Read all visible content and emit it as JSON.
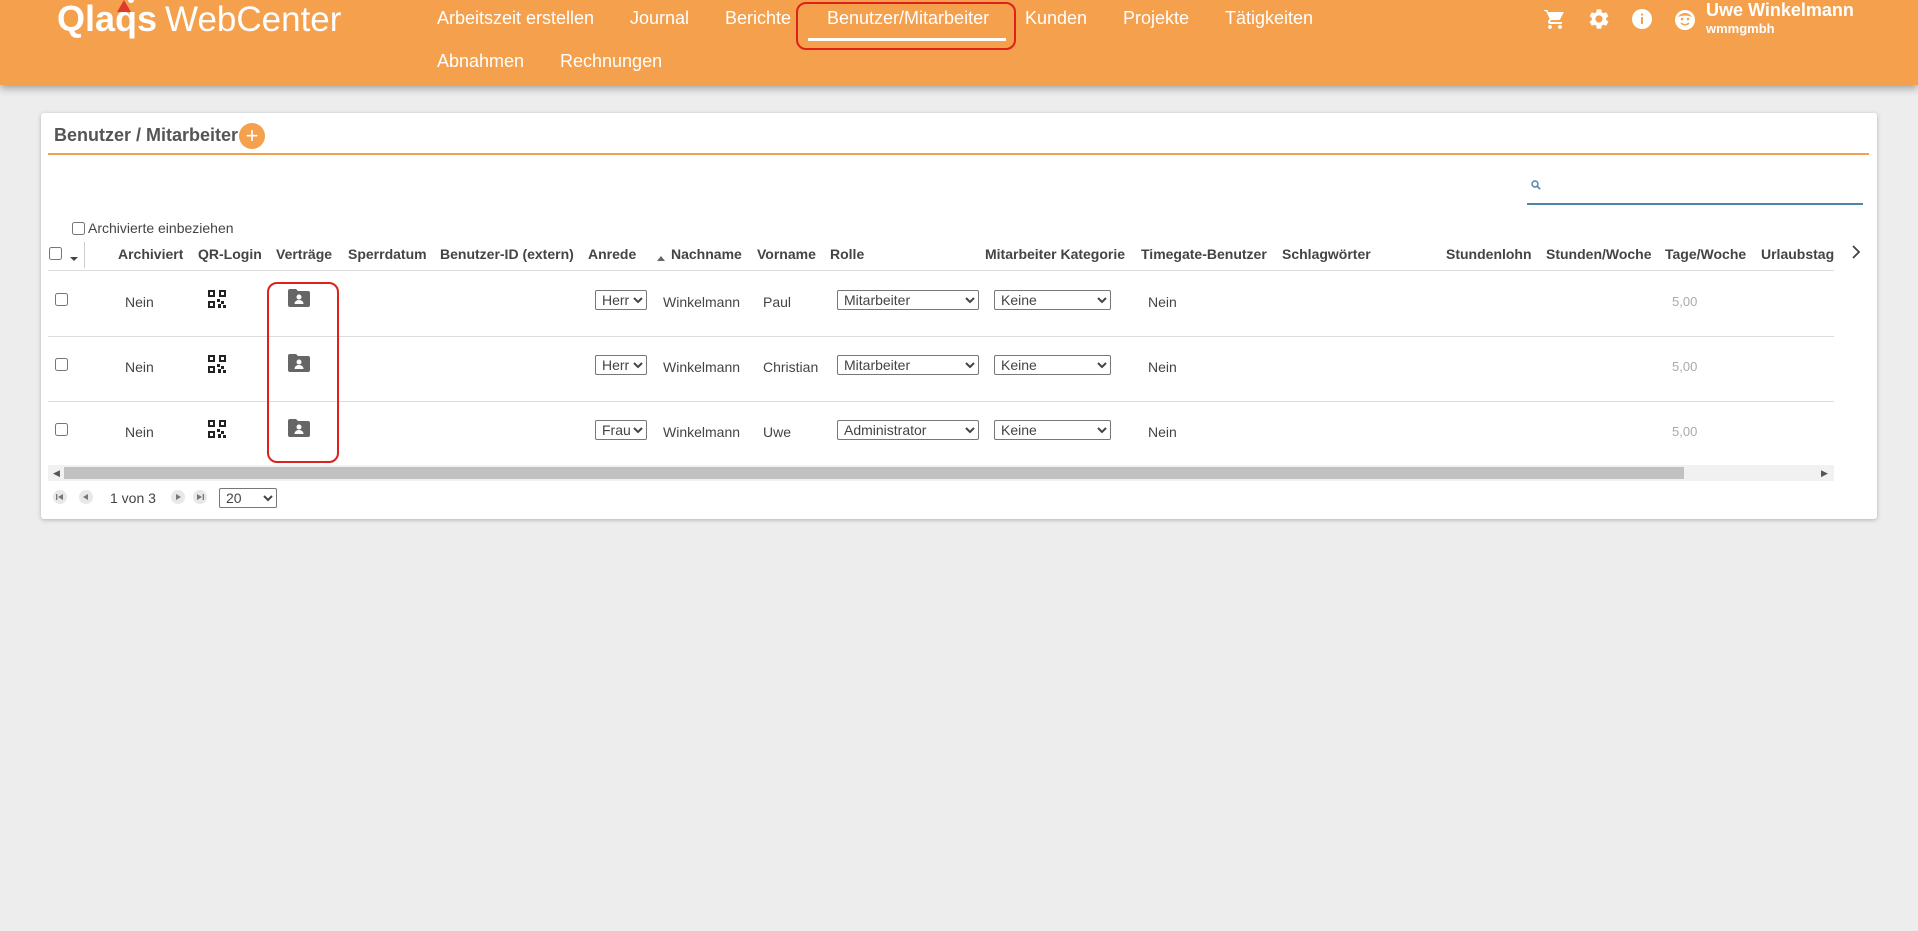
{
  "header": {
    "logo_brand": "Qlaqs",
    "logo_suffix": "WebCenter",
    "nav": [
      {
        "label": "Arbeitszeit erstellen"
      },
      {
        "label": "Journal"
      },
      {
        "label": "Berichte"
      },
      {
        "label": "Benutzer/Mitarbeiter",
        "active": true
      },
      {
        "label": "Kunden"
      },
      {
        "label": "Projekte"
      },
      {
        "label": "Tätigkeiten"
      },
      {
        "label": "Abnahmen"
      },
      {
        "label": "Rechnungen"
      }
    ],
    "icons": [
      "cart-icon",
      "gear-icon",
      "info-icon",
      "user-avatar-icon"
    ],
    "user_name": "Uwe Winkelmann",
    "user_company": "wmmgmbh",
    "accent_color": "#f5a04d"
  },
  "card": {
    "title": "Benutzer / Mitarbeiter",
    "add_label": "+",
    "archived_label": "Archivierte einbeziehen",
    "search_placeholder": ""
  },
  "table": {
    "columns": [
      "Archiviert",
      "QR-Login",
      "Verträge",
      "Sperrdatum",
      "Benutzer-ID (extern)",
      "Anrede",
      "Nachname",
      "Vorname",
      "Rolle",
      "Mitarbeiter Kategorie",
      "Timegate-Benutzer",
      "Schlagwörter",
      "Stundenlohn",
      "Stunden/Woche",
      "Tage/Woche",
      "Urlaubstag"
    ],
    "sorted_column": "Nachname",
    "sort_direction": "ascending",
    "rows": [
      {
        "archiviert": "Nein",
        "anrede": "Herr",
        "nachname": "Winkelmann",
        "vorname": "Paul",
        "rolle": "Mitarbeiter",
        "kategorie": "Keine",
        "timegate": "Nein",
        "tage_woche": "5,00"
      },
      {
        "archiviert": "Nein",
        "anrede": "Herr",
        "nachname": "Winkelmann",
        "vorname": "Christian",
        "rolle": "Mitarbeiter",
        "kategorie": "Keine",
        "timegate": "Nein",
        "tage_woche": "5,00"
      },
      {
        "archiviert": "Nein",
        "anrede": "Frau",
        "nachname": "Winkelmann",
        "vorname": "Uwe",
        "rolle": "Administrator",
        "kategorie": "Keine",
        "timegate": "Nein",
        "tage_woche": "5,00"
      }
    ]
  },
  "pager": {
    "page_text": "1 von 3",
    "page_size": "20"
  }
}
